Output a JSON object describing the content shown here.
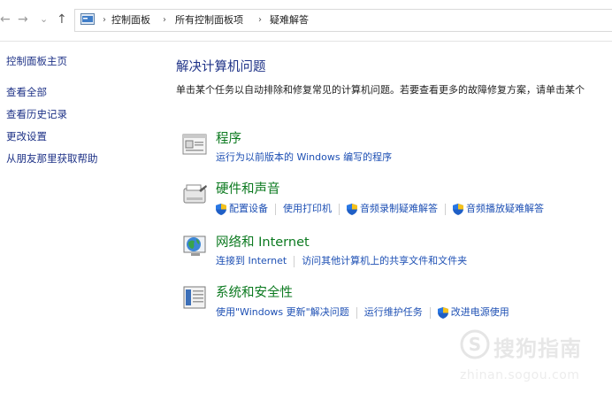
{
  "address_bar": {
    "back_glyph": "←",
    "forward_glyph": "→",
    "recent_glyph": "⌄",
    "up_glyph": "↑",
    "crumbs": [
      "控制面板",
      "所有控制面板项",
      "疑难解答"
    ],
    "separator": "›"
  },
  "sidebar": {
    "items": [
      {
        "label": "控制面板主页"
      },
      {
        "label": "查看全部"
      },
      {
        "label": "查看历史记录"
      },
      {
        "label": "更改设置"
      },
      {
        "label": "从朋友那里获取帮助"
      }
    ]
  },
  "main": {
    "title": "解决计算机问题",
    "description": "单击某个任务以自动排除和修复常见的计算机问题。若要查看更多的故障修复方案，请单击某个"
  },
  "categories": [
    {
      "title": "程序",
      "icon": "programs-icon",
      "links": [
        {
          "label": "运行为以前版本的 Windows 编写的程序",
          "shield": false
        }
      ]
    },
    {
      "title": "硬件和声音",
      "icon": "hardware-sound-icon",
      "links": [
        {
          "label": "配置设备",
          "shield": true
        },
        {
          "label": "使用打印机",
          "shield": false
        },
        {
          "label": "音频录制疑难解答",
          "shield": true
        },
        {
          "label": "音频播放疑难解答",
          "shield": true
        }
      ]
    },
    {
      "title": "网络和 Internet",
      "icon": "network-internet-icon",
      "links": [
        {
          "label": "连接到 Internet",
          "shield": false
        },
        {
          "label": "访问其他计算机上的共享文件和文件夹",
          "shield": false
        }
      ]
    },
    {
      "title": "系统和安全性",
      "icon": "system-security-icon",
      "links": [
        {
          "label": "使用\"Windows 更新\"解决问题",
          "shield": false
        },
        {
          "label": "运行维护任务",
          "shield": false
        },
        {
          "label": "改进电源使用",
          "shield": true
        }
      ]
    }
  ],
  "watermark": {
    "text": "搜狗指南",
    "url": "zhinan.sogou.com"
  },
  "colors": {
    "link_blue": "#1e50b4",
    "category_green": "#0c7a20",
    "title_blue": "#1e3287"
  }
}
